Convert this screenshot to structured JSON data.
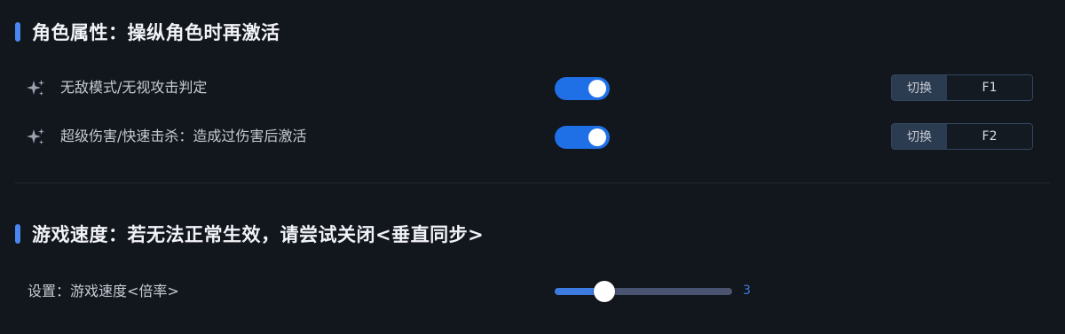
{
  "colors": {
    "background": "#12161d",
    "accent": "#1f6fe6",
    "slider_fill": "#3d7be0",
    "slider_track": "#4a5470"
  },
  "sections": [
    {
      "title": "角色属性：操纵角色时再激活",
      "items": [
        {
          "icon": "sparkle-icon",
          "label": "无敌模式/无视攻击判定",
          "toggle_on": true,
          "switch_label": "切换",
          "hotkey": "F1"
        },
        {
          "icon": "sparkle-icon",
          "label": "超级伤害/快速击杀：造成过伤害后激活",
          "toggle_on": true,
          "switch_label": "切换",
          "hotkey": "F2"
        }
      ]
    },
    {
      "title": "游戏速度：若无法正常生效，请尝试关闭<垂直同步>",
      "slider": {
        "label": "设置：游戏速度<倍率>",
        "value": "3",
        "fraction": 0.28
      }
    }
  ]
}
